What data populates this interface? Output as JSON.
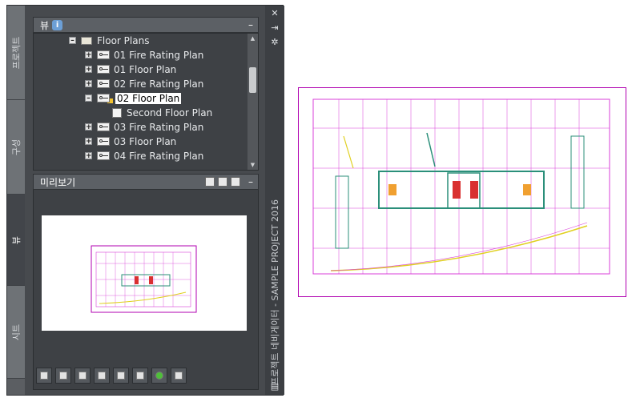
{
  "palette": {
    "side_tabs": [
      "프로젝트",
      "구성",
      "뷰",
      "시트"
    ],
    "active_tab": "뷰",
    "title": "프로젝트 네비게이터 - SAMPLE PROJECT 2016",
    "controls": [
      "close-icon",
      "autohide-icon",
      "properties-icon"
    ]
  },
  "views_section": {
    "label": "뷰",
    "info_icon": "i",
    "minimize": "–"
  },
  "tree": {
    "root": "Floor Plans",
    "items": [
      {
        "label": "01 Fire Rating Plan"
      },
      {
        "label": "01 Floor Plan"
      },
      {
        "label": "02 Fire Rating Plan"
      },
      {
        "label": "02 Floor Plan",
        "selected": true
      },
      {
        "label": "Second Floor Plan",
        "child": true
      },
      {
        "label": "03 Fire Rating Plan"
      },
      {
        "label": "03 Floor Plan"
      },
      {
        "label": "04 Fire Rating Plan"
      }
    ]
  },
  "preview_section": {
    "label": "미리보기",
    "minimize": "–"
  },
  "toolbar_icons": [
    "add-view-icon",
    "add-detail-icon",
    "add-section-icon",
    "reposition-icon",
    "edit-icon",
    "properties-icon",
    "refresh-icon",
    "regenerate-icon"
  ],
  "colors": {
    "plan_border": "#b000b0",
    "plan_lines": "#d83fd8",
    "plan_green": "#2b8f7a",
    "selection": "#ffffff"
  }
}
